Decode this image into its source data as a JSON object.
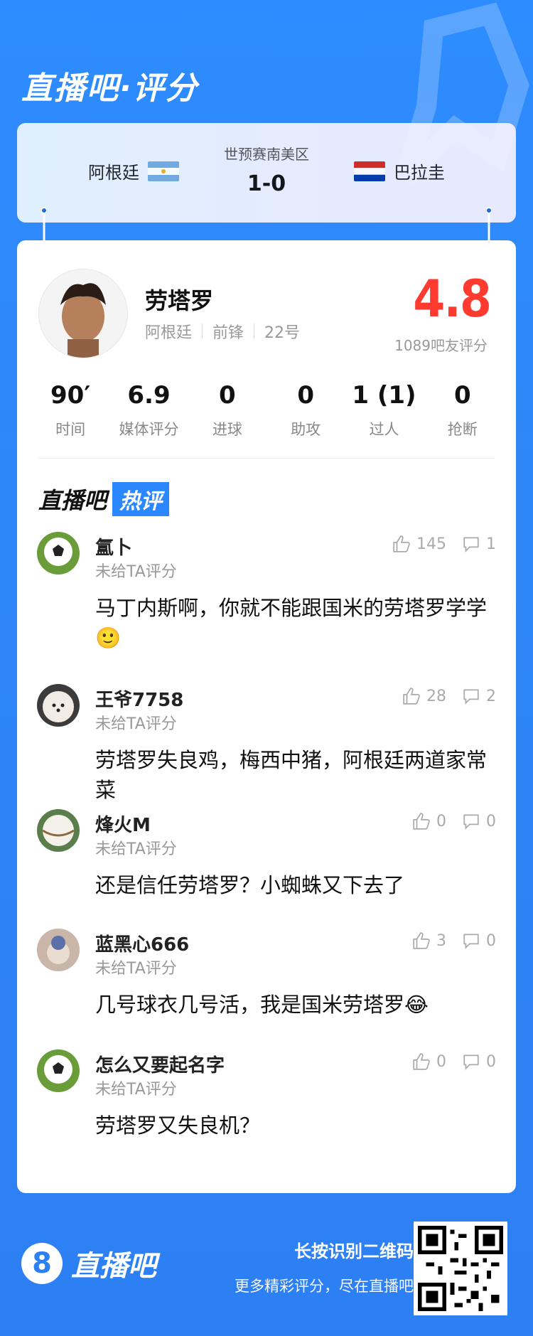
{
  "brand": {
    "title": "直播吧·评分"
  },
  "match": {
    "competition": "世预赛南美区",
    "score": "1-0",
    "home_team": "阿根廷",
    "away_team": "巴拉圭"
  },
  "player": {
    "name": "劳塔罗",
    "team": "阿根廷",
    "position": "前锋",
    "number": "22号",
    "rating": "4.8",
    "rating_note": "1089吧友评分",
    "stats": [
      {
        "value": "90′",
        "label": "时间"
      },
      {
        "value": "6.9",
        "label": "媒体评分"
      },
      {
        "value": "0",
        "label": "进球"
      },
      {
        "value": "0",
        "label": "助攻"
      },
      {
        "value": "1 (1)",
        "label": "过人"
      },
      {
        "value": "0",
        "label": "抢断"
      }
    ]
  },
  "hot_section": {
    "prefix": "直播吧",
    "tag": "热评"
  },
  "comments": [
    {
      "user": "氲卜",
      "sub": "未给TA评分",
      "text": "马丁内斯啊，你就不能跟国米的劳塔罗学学🙂",
      "likes": "145",
      "dislikes": "1"
    },
    {
      "user": "王爷7758",
      "sub": "未给TA评分",
      "text": "劳塔罗失良鸡，梅西中猪，阿根廷两道家常菜",
      "likes": "28",
      "dislikes": "2"
    },
    {
      "user": "烽火M",
      "sub": "未给TA评分",
      "text": "还是信任劳塔罗？小蜘蛛又下去了",
      "likes": "0",
      "dislikes": "0"
    },
    {
      "user": "蓝黑心666",
      "sub": "未给TA评分",
      "text": "几号球衣几号活，我是国米劳塔罗😂",
      "likes": "3",
      "dislikes": "0"
    },
    {
      "user": "怎么又要起名字",
      "sub": "未给TA评分",
      "text": "劳塔罗又失良机？",
      "likes": "0",
      "dislikes": "0"
    }
  ],
  "footer": {
    "logo_number": "8",
    "logo_text": "直播吧",
    "line1": "长按识别二维码",
    "line2": "更多精彩评分，尽在直播吧"
  },
  "colors": {
    "accent": "#2d80f3",
    "rating": "#ff3b30"
  }
}
